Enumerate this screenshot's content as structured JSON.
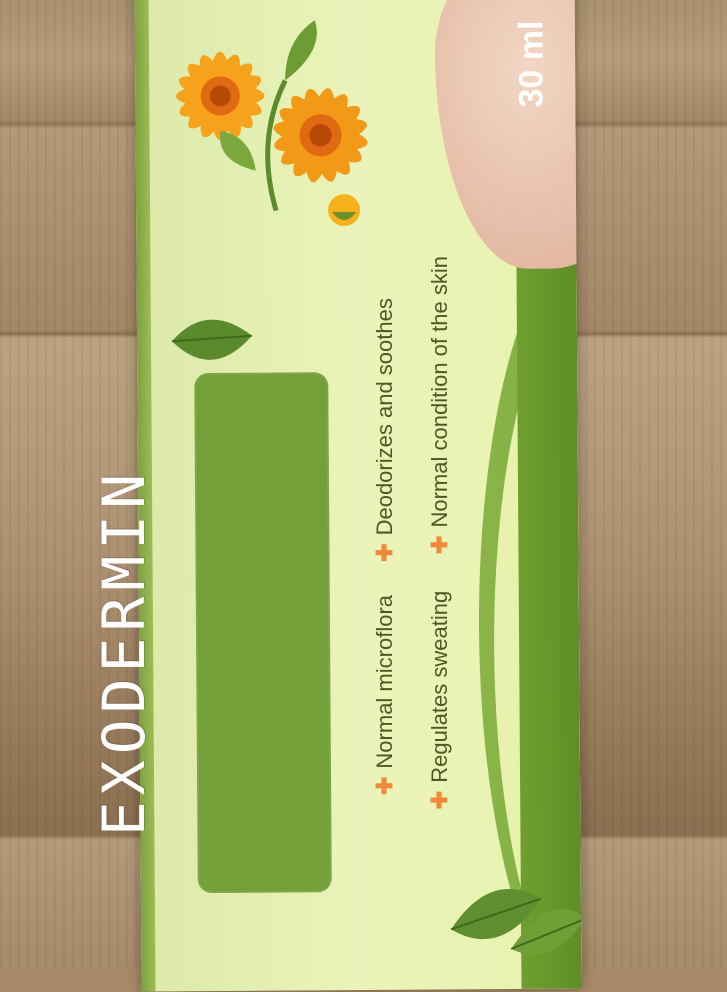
{
  "product": {
    "brand": "EXODERMIN",
    "volume": "30 ml",
    "benefits": [
      "Normal microflora",
      "Regulates sweating",
      "Deodorizes and soothes",
      "Normal condition of the skin"
    ]
  },
  "colors": {
    "box_light": "#e8f2ae",
    "brand_green": "#74a03a",
    "band_green": "#6f9f2f",
    "accent_orange": "#f08a3a",
    "text_dark": "#4b5a24"
  },
  "icons": [
    "calendula-flower-icon",
    "birch-leaf-icon",
    "foot-illustration",
    "plus-icon"
  ]
}
